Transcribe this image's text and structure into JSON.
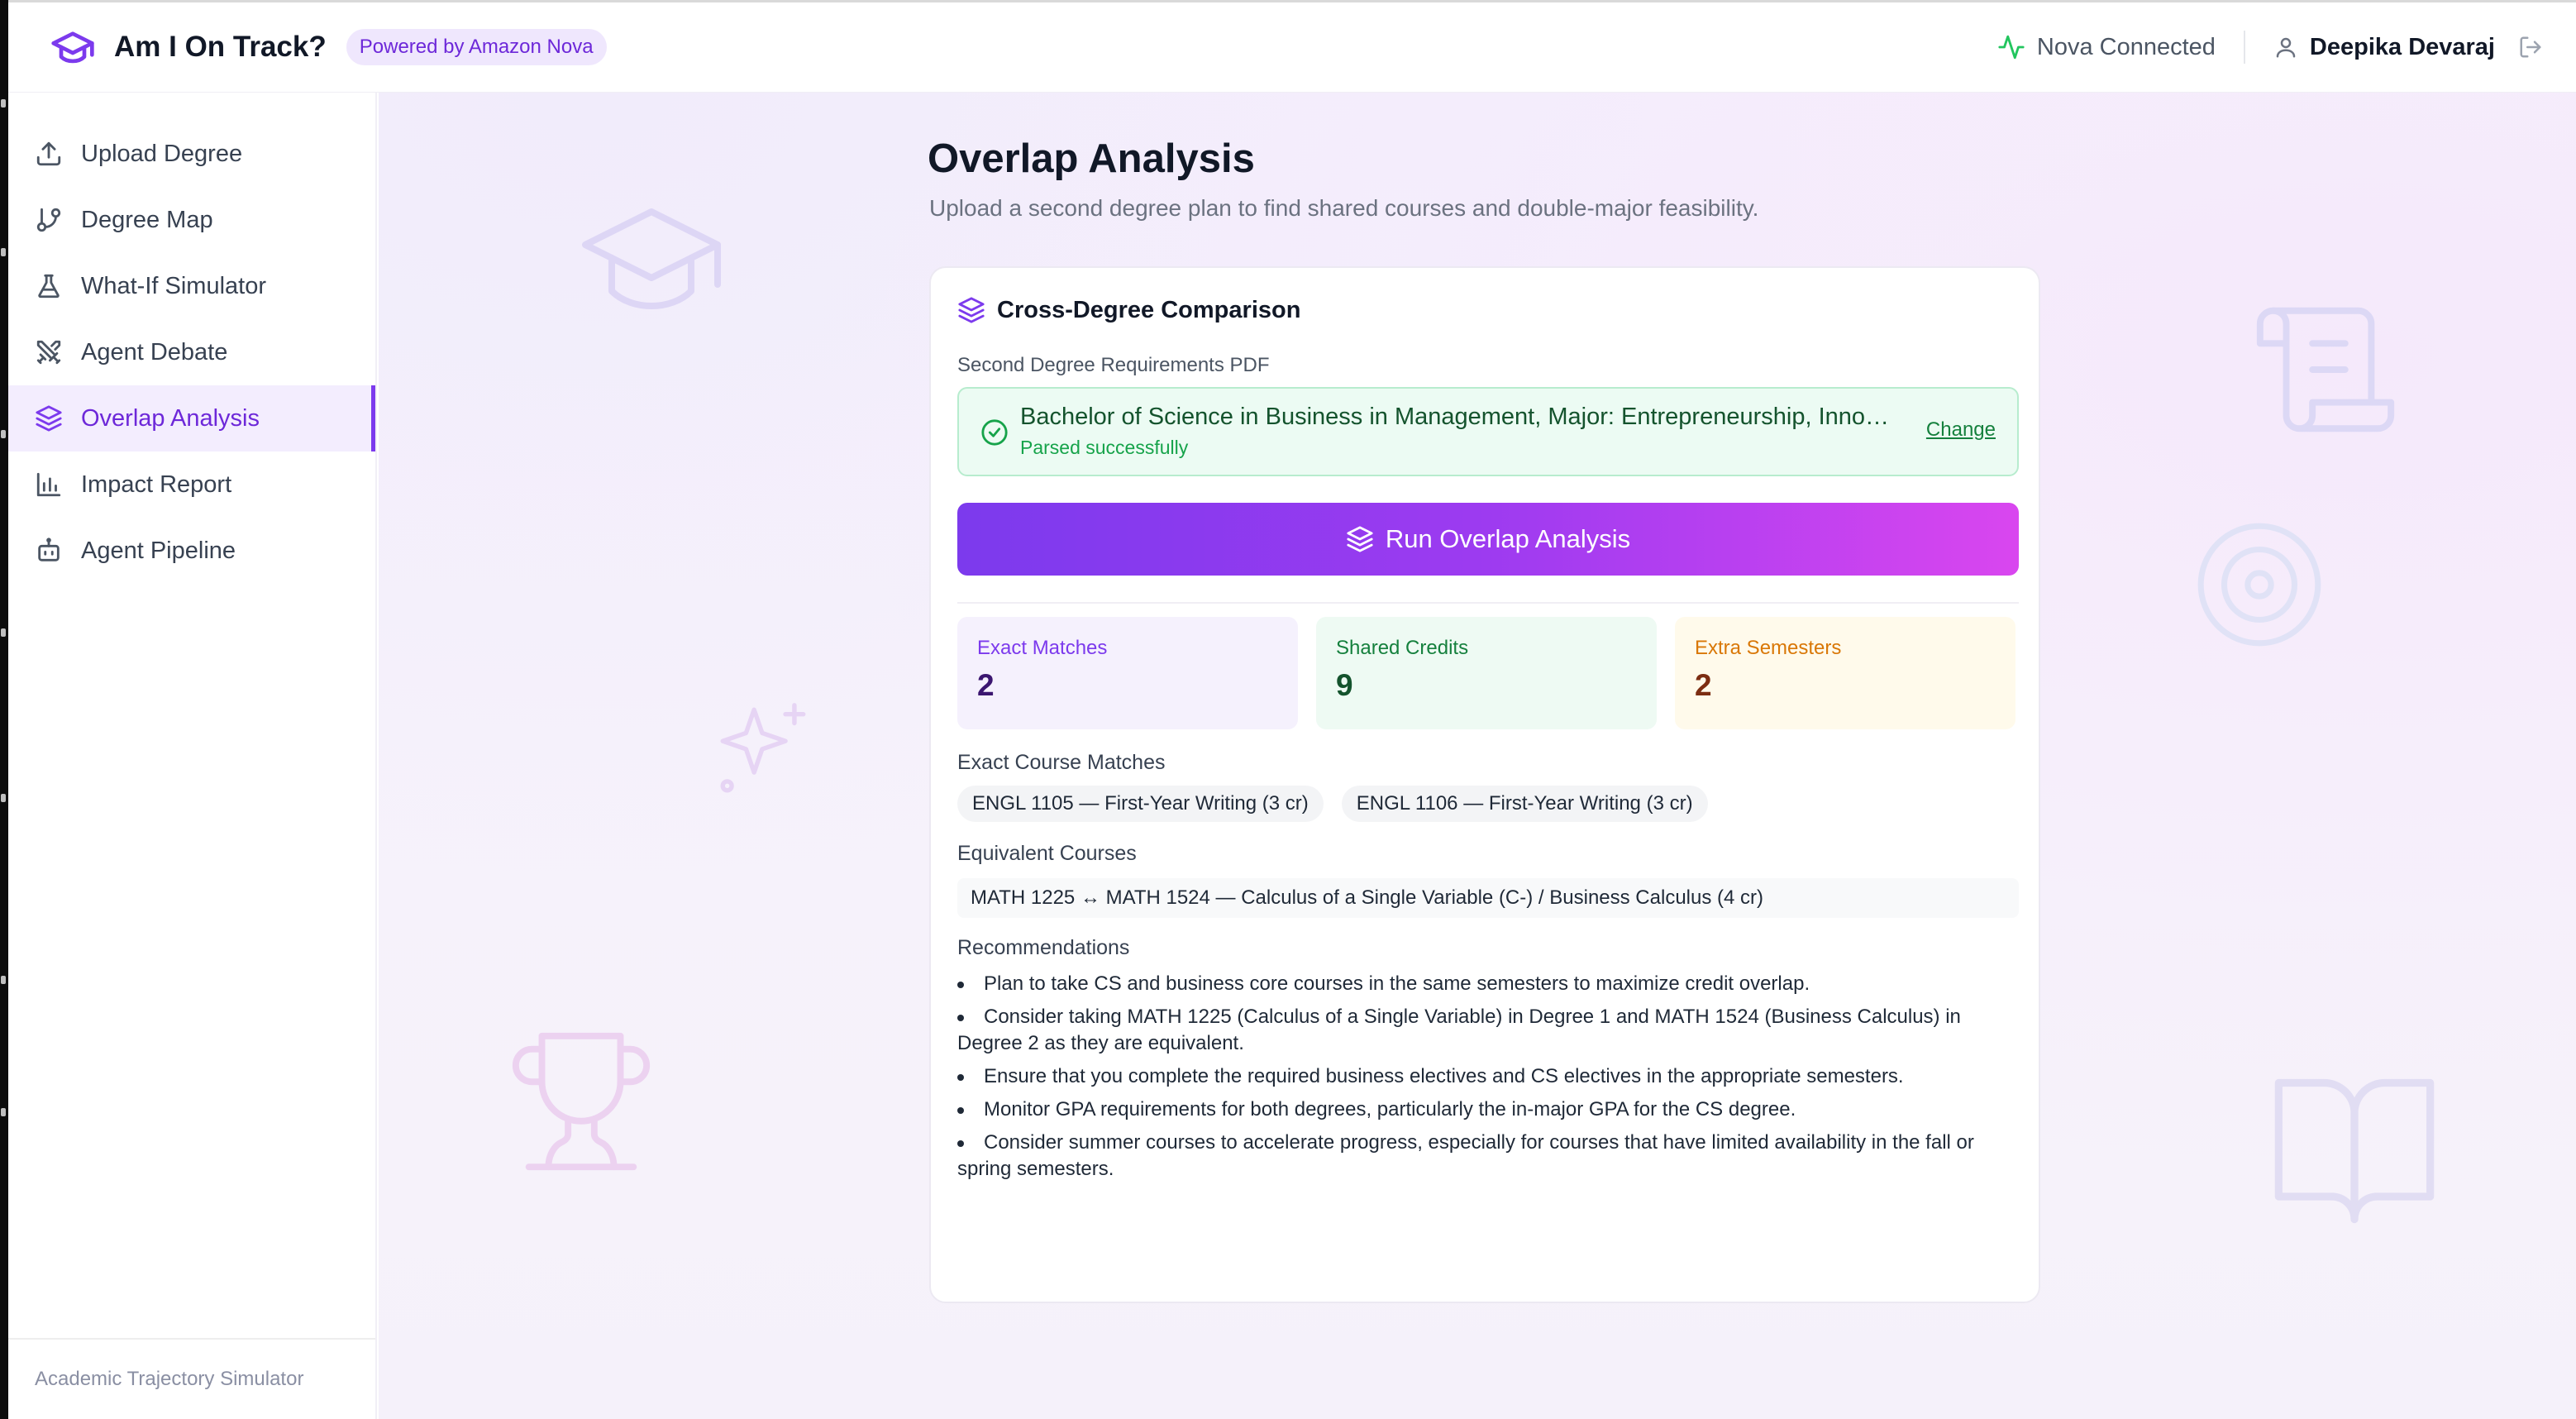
{
  "app": {
    "title": "Am I On Track?",
    "badge": "Powered by Amazon Nova",
    "status": "Nova Connected",
    "user_name": "Deepika Devaraj",
    "accent": "#7c3aed"
  },
  "sidebar": {
    "items": [
      {
        "label": "Upload Degree",
        "icon": "upload-icon"
      },
      {
        "label": "Degree Map",
        "icon": "git-branch-icon"
      },
      {
        "label": "What-If Simulator",
        "icon": "flask-icon"
      },
      {
        "label": "Agent Debate",
        "icon": "swords-icon"
      },
      {
        "label": "Overlap Analysis",
        "icon": "layers-icon",
        "active": true
      },
      {
        "label": "Impact Report",
        "icon": "bar-chart-icon"
      },
      {
        "label": "Agent Pipeline",
        "icon": "bot-icon"
      }
    ],
    "footer": "Academic Trajectory Simulator"
  },
  "main": {
    "title": "Overlap Analysis",
    "subtitle": "Upload a second degree plan to find shared courses and double-major feasibility."
  },
  "card": {
    "title": "Cross-Degree Comparison",
    "field_label": "Second Degree Requirements PDF",
    "file_name": "Bachelor of Science in Business in Management, Major: Entrepreneurship, Innovation and Technology",
    "file_status": "Parsed successfully",
    "change_label": "Change",
    "run_label": "Run Overlap Analysis",
    "stats": [
      {
        "label": "Exact Matches",
        "value": "2"
      },
      {
        "label": "Shared Credits",
        "value": "9"
      },
      {
        "label": "Extra Semesters",
        "value": "2"
      }
    ],
    "exact_label": "Exact Course Matches",
    "exact_matches": [
      "ENGL 1105 — First-Year Writing (3 cr)",
      "ENGL 1106 — First-Year Writing (3 cr)"
    ],
    "equiv_label": "Equivalent Courses",
    "equivalents": [
      "MATH 1225 ↔ MATH 1524 — Calculus of a Single Variable (C-) / Business Calculus (4 cr)"
    ],
    "rec_label": "Recommendations",
    "recommendations": [
      "Plan to take CS and business core courses in the same semesters to maximize credit overlap.",
      "Consider taking MATH 1225 (Calculus of a Single Variable) in Degree 1 and MATH 1524 (Business Calculus) in Degree 2 as they are equivalent.",
      "Ensure that you complete the required business electives and CS electives in the appropriate semesters.",
      "Monitor GPA requirements for both degrees, particularly the in-major GPA for the CS degree.",
      "Consider summer courses to accelerate progress, especially for courses that have limited availability in the fall or spring semesters."
    ]
  }
}
